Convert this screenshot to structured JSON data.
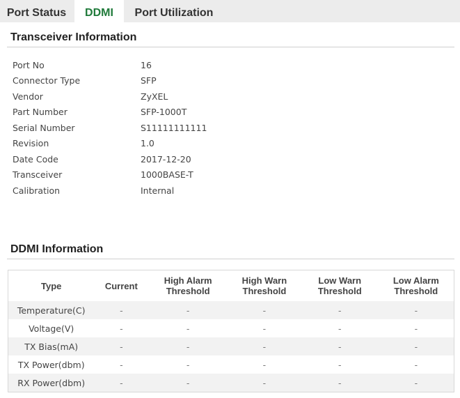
{
  "tabs": [
    {
      "label": "Port Status",
      "active": false
    },
    {
      "label": "DDMI",
      "active": true
    },
    {
      "label": "Port Utilization",
      "active": false
    }
  ],
  "transceiver": {
    "title": "Transceiver Information",
    "rows": [
      {
        "label": "Port No",
        "value": "16"
      },
      {
        "label": "Connector Type",
        "value": "SFP"
      },
      {
        "label": "Vendor",
        "value": "ZyXEL"
      },
      {
        "label": "Part Number",
        "value": "SFP-1000T"
      },
      {
        "label": "Serial Number",
        "value": "S11111111111"
      },
      {
        "label": "Revision",
        "value": "1.0"
      },
      {
        "label": "Date Code",
        "value": "2017-12-20"
      },
      {
        "label": "Transceiver",
        "value": "1000BASE-T"
      },
      {
        "label": "Calibration",
        "value": "Internal"
      }
    ]
  },
  "ddmi": {
    "title": "DDMI Information",
    "columns": [
      "Type",
      "Current",
      "High Alarm Threshold",
      "High Warn Threshold",
      "Low Warn Threshold",
      "Low Alarm Threshold"
    ],
    "rows": [
      [
        "Temperature(C)",
        "-",
        "-",
        "-",
        "-",
        "-"
      ],
      [
        "Voltage(V)",
        "-",
        "-",
        "-",
        "-",
        "-"
      ],
      [
        "TX Bias(mA)",
        "-",
        "-",
        "-",
        "-",
        "-"
      ],
      [
        "TX Power(dbm)",
        "-",
        "-",
        "-",
        "-",
        "-"
      ],
      [
        "RX Power(dbm)",
        "-",
        "-",
        "-",
        "-",
        "-"
      ]
    ]
  },
  "colors": {
    "active_tab": "#1f7a3a",
    "tab_bar": "#ececec",
    "row_stripe": "#f2f2f2"
  }
}
